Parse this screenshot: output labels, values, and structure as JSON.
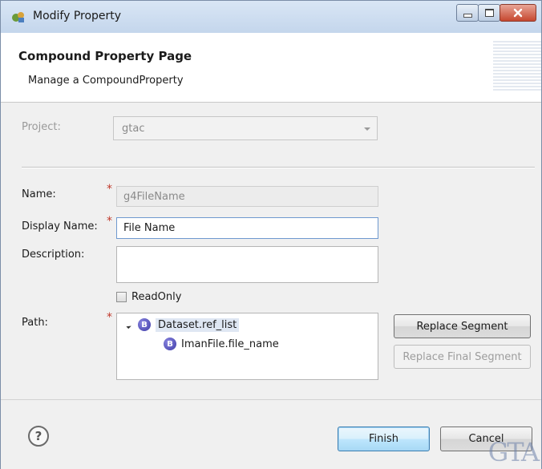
{
  "window": {
    "title": "Modify Property",
    "icon": "eclipse-property-icon"
  },
  "header": {
    "title": "Compound Property Page",
    "subtitle": "Manage a CompoundProperty"
  },
  "form": {
    "project_label": "Project:",
    "project_value": "gtac",
    "name_label": "Name:",
    "name_value": "g4FileName",
    "display_name_label": "Display Name:",
    "display_name_value": "File Name",
    "description_label": "Description:",
    "description_value": "",
    "readonly_label": "ReadOnly",
    "readonly_checked": false,
    "path_label": "Path:",
    "required_marker": "*"
  },
  "path_tree": {
    "items": [
      {
        "icon_letter": "B",
        "label": "Dataset.ref_list",
        "expanded": true,
        "selected": true
      },
      {
        "icon_letter": "B",
        "label": "ImanFile.file_name",
        "expanded": false,
        "selected": false
      }
    ]
  },
  "buttons": {
    "replace_segment": "Replace Segment",
    "replace_final_segment": "Replace Final Segment",
    "finish": "Finish",
    "cancel": "Cancel"
  },
  "footer": {
    "help_symbol": "?",
    "watermark": "GTA"
  },
  "colors": {
    "required_star": "#c0392b",
    "default_button_border": "#3c7fb1",
    "title_bar": "#c4d6ec"
  }
}
